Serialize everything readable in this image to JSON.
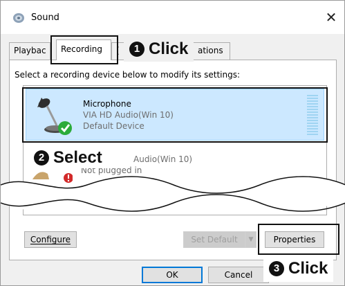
{
  "window": {
    "title": "Sound",
    "close_glyph": "✕",
    "icon": "speaker-icon"
  },
  "tabs": [
    {
      "label": "Playbac",
      "selected": false
    },
    {
      "label": "Recording",
      "selected": true
    },
    {
      "label": "(",
      "selected": false
    },
    {
      "label": "ations",
      "selected": false
    }
  ],
  "instructions": "Select a recording device below to modify its settings:",
  "devices": [
    {
      "name": "Microphone",
      "driver": "VIA HD Audio(Win 10)",
      "status": "Default Device",
      "icon": "microphone-icon",
      "badge": "check-icon",
      "selected": true
    },
    {
      "name": "",
      "driver": "Audio(Win 10)",
      "status": "Not plugged in",
      "icon": "line-in-icon",
      "badge": "unplugged-icon",
      "selected": false
    }
  ],
  "callouts": [
    {
      "number": "1",
      "text": "Click"
    },
    {
      "number": "2",
      "text": "Select"
    },
    {
      "number": "3",
      "text": "Click"
    }
  ],
  "buttons": {
    "configure": "Configure",
    "set_default": "Set Default",
    "set_default_arrow": "▼",
    "properties": "Properties",
    "ok": "OK",
    "cancel": "Cancel"
  },
  "colors": {
    "selection": "#cce8ff",
    "accent": "#0078d7",
    "check": "#2bab3a",
    "unplugged": "#d22a2a"
  }
}
